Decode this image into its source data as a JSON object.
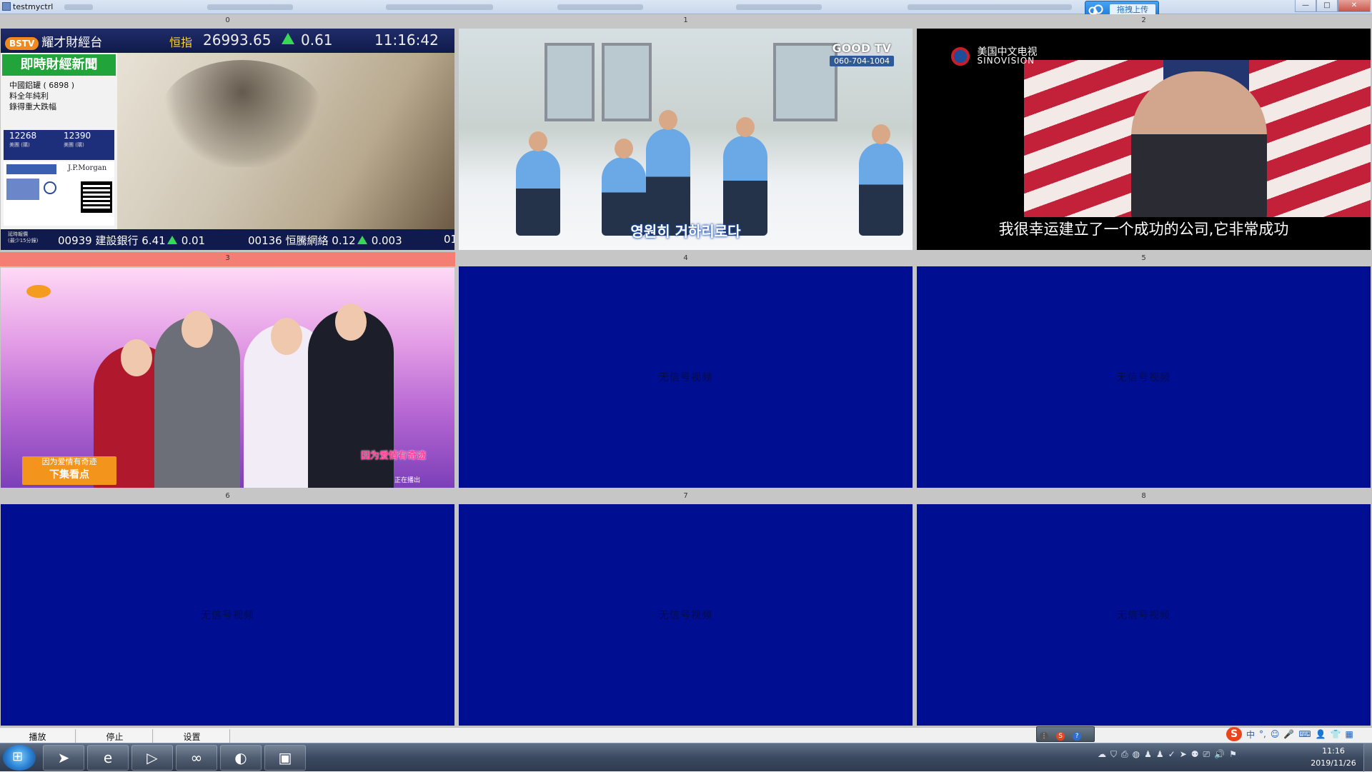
{
  "window": {
    "title": "testmyctrl",
    "upload_button_label": "拖拽上传",
    "controls": {
      "minimize": "—",
      "maximize": "□",
      "close": "✕"
    }
  },
  "grid": {
    "no_signal_text": "无信号视频",
    "selected_index": 3,
    "cells": [
      {
        "index": "0",
        "type": "finance"
      },
      {
        "index": "1",
        "type": "music"
      },
      {
        "index": "2",
        "type": "news"
      },
      {
        "index": "3",
        "type": "drama"
      },
      {
        "index": "4",
        "type": "empty"
      },
      {
        "index": "5",
        "type": "empty"
      },
      {
        "index": "6",
        "type": "empty"
      },
      {
        "index": "7",
        "type": "empty"
      },
      {
        "index": "8",
        "type": "empty"
      }
    ]
  },
  "finance": {
    "channel_badge": "BSTV",
    "channel_name": "耀才財經台",
    "index_label": "恒指",
    "index_value": "26993.65",
    "index_change": "0.61",
    "clock": "11:16:42",
    "news_header": "即時財經新聞",
    "news_lines": [
      "中國鋁罐 ( 6898 )",
      "料全年純利",
      "錄得重大跌幅"
    ],
    "quotes": [
      {
        "value": "12268",
        "name": "美團 (購)"
      },
      {
        "value": "12390",
        "name": "美團 (購)"
      }
    ],
    "sponsor": "J.P.Morgan",
    "ticker_label": "延時報價",
    "ticker_sub": "(最少15分鐘)",
    "ticker_items": [
      {
        "code": "00939",
        "name": "建設銀行",
        "price": "6.41",
        "change": "0.01"
      },
      {
        "code": "00136",
        "name": "恒騰網絡",
        "price": "0.12",
        "change": "0.003"
      }
    ],
    "ticker_tail": "01"
  },
  "music": {
    "subtitle": "영원히 거하리로다",
    "brand": "GOOD TV",
    "phone": "060-704-1004"
  },
  "news": {
    "logo_cn": "美国中文电视",
    "logo_en": "SINOVISION",
    "subtitle": "我很幸运建立了一个成功的公司,它非常成功"
  },
  "drama": {
    "banner_line1": "因为爱情有奇迹",
    "banner_line2": "下集看点",
    "title": "因为爱情有奇迹",
    "now_playing": "正在播出"
  },
  "controls": {
    "play": "播放",
    "stop": "停止",
    "settings": "设置"
  },
  "ime": {
    "mode": "中"
  },
  "taskbar": {
    "time": "11:16",
    "date": "2019/11/26",
    "apps": [
      "qq-browser-icon",
      "ie-icon",
      "visual-studio-icon",
      "infinity-icon",
      "media-player-icon",
      "office-icon"
    ]
  },
  "colors": {
    "no_signal_bg": "#000f92",
    "selected_header": "#f47e74",
    "cell_header": "#c6c6c6"
  }
}
